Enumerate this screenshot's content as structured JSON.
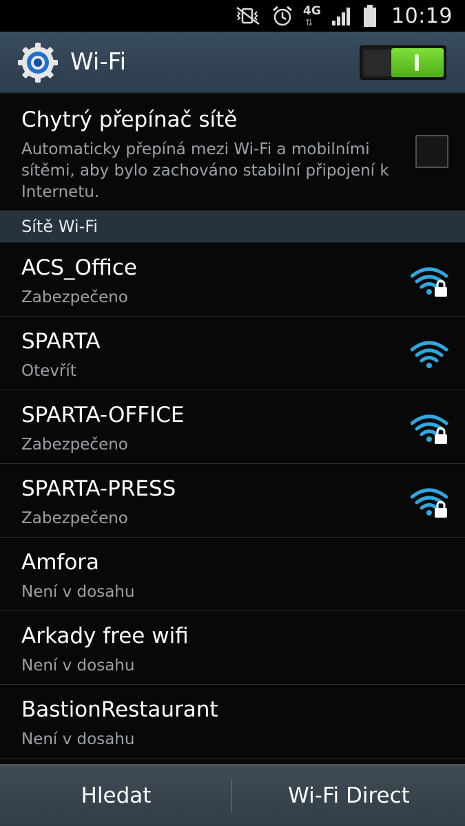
{
  "status_bar": {
    "time": "10:19",
    "network_type": "4G",
    "icons": [
      "vibrate-mute-icon",
      "alarm-icon",
      "network-4g-icon",
      "signal-strength-icon",
      "battery-icon"
    ]
  },
  "action_bar": {
    "title": "Wi-Fi",
    "icon": "settings-gear-icon",
    "wifi_enabled": true,
    "accent_color": "#5fc520"
  },
  "smart_switch": {
    "title": "Chytrý přepínač sítě",
    "description": "Automaticky přepíná mezi Wi-Fi a mobilními sítěmi, aby bylo zachováno stabilní připojení k Internetu.",
    "checked": false
  },
  "section": {
    "title": "Sítě Wi-Fi"
  },
  "networks": [
    {
      "name": "ACS_Office",
      "status": "Zabezpečeno",
      "icon": "wifi-locked-icon",
      "secured": true,
      "in_range": true
    },
    {
      "name": "SPARTA",
      "status": "Otevřít",
      "icon": "wifi-icon",
      "secured": false,
      "in_range": true
    },
    {
      "name": "SPARTA-OFFICE",
      "status": "Zabezpečeno",
      "icon": "wifi-locked-icon",
      "secured": true,
      "in_range": true
    },
    {
      "name": "SPARTA-PRESS",
      "status": "Zabezpečeno",
      "icon": "wifi-locked-icon",
      "secured": true,
      "in_range": true
    },
    {
      "name": "Amfora",
      "status": "Není v dosahu",
      "in_range": false
    },
    {
      "name": "Arkady free wifi",
      "status": "Není v dosahu",
      "in_range": false
    },
    {
      "name": "BastionRestaurant",
      "status": "Není v dosahu",
      "in_range": false
    }
  ],
  "bottom_bar": {
    "scan_label": "Hledat",
    "direct_label": "Wi-Fi Direct"
  },
  "colors": {
    "wifi_icon": "#2ea8e0",
    "subtext": "#9aa1a8",
    "action_bar": "#34475a"
  }
}
